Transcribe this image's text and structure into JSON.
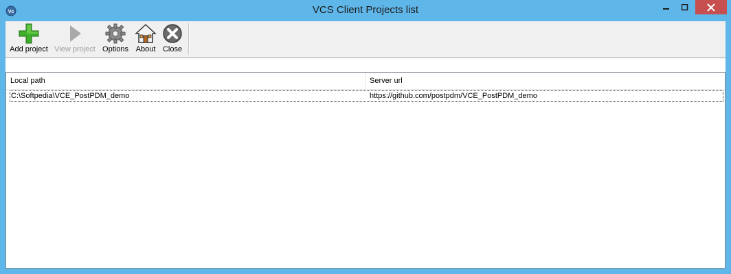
{
  "window": {
    "title": "VCS Client Projects list",
    "app_icon": "vcs-app-icon",
    "titlebar_color": "#5fb6e8",
    "close_button_color": "#c74f50"
  },
  "toolbar": {
    "items": [
      {
        "label": "Add project",
        "icon": "plus-icon",
        "enabled": true
      },
      {
        "label": "View project",
        "icon": "play-arrow-icon",
        "enabled": false
      },
      {
        "label": "Options",
        "icon": "gear-icon",
        "enabled": true
      },
      {
        "label": "About",
        "icon": "house-icon",
        "enabled": true
      },
      {
        "label": "Close",
        "icon": "close-circle-icon",
        "enabled": true
      }
    ]
  },
  "table": {
    "columns": [
      "Local path",
      "Server url"
    ],
    "rows": [
      {
        "local_path": "C:\\Softpedia\\VCE_PostPDM_demo",
        "server_url": "https://github.com/postpdm/VCE_PostPDM_demo"
      }
    ]
  }
}
